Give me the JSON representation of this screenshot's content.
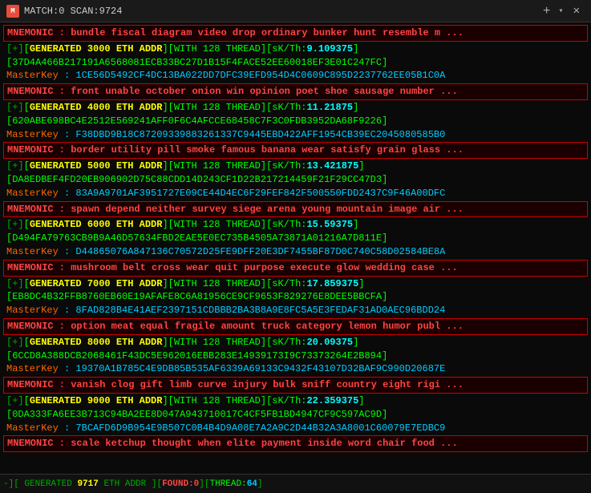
{
  "titleBar": {
    "icon": "M",
    "text": "MATCH:0 SCAN:9724",
    "closeLabel": "✕",
    "newTabLabel": "+",
    "dropdownLabel": "▾"
  },
  "statusBar": {
    "prefix": "-][",
    "generated": "GENERATED",
    "scan": "9717",
    "eth": "ETH ADDR",
    "found_label": "FOUND:",
    "found_value": "0",
    "thread_label": "THREAD:",
    "thread_value": "64"
  },
  "entries": [
    {
      "mnemonic": "MNEMONIC : bundle fiscal diagram video drop ordinary bunker hunt resemble m ...",
      "generated": "[+][GENERATED 3000 ETH ADDR][WITH 128 THREAD][sK/Th:9.109375]",
      "addr": "[37D4A466B217191A6568081ECB33BC27D1B15F4FACE52EE60018EF3E01C247FC]",
      "masterkey": "MasterKey :  1CE56D5492CF4DC13BA022DD7DFC39EFD954D4C0609C895D2237762EE05B1C0A"
    },
    {
      "mnemonic": "MNEMONIC : front unable october onion win opinion poet shoe sausage number ...",
      "generated": "[+][GENERATED 4000 ETH ADDR][WITH 128 THREAD][sK/Th:11.21875]",
      "addr": "[620ABE698BC4E2512E569241AFF0F6C4AFCCE68458C7F3C0FDB3952DA68F9226]",
      "masterkey": "MasterKey :  F38DBD9B18C87209339883261337C9445EBD422AFF1954CB39EC2045080585B0"
    },
    {
      "mnemonic": "MNEMONIC : border utility pill smoke famous banana wear satisfy grain glass ...",
      "generated": "[+][GENERATED 5000 ETH ADDR][WITH 128 THREAD][sK/Th:13.421875]",
      "addr": "[DA8EDBEF4FD20EB906902D75C88CDD14D243CF1D22B217214459F21F29CC47D3]",
      "masterkey": "MasterKey :  83A9A9701AF3951727E09CE44D4EC6F29FEF842F500550FDD2437C9F46A00DFC"
    },
    {
      "mnemonic": "MNEMONIC : spawn depend neither survey siege arena young mountain image air ...",
      "generated": "[+][GENERATED 6000 ETH ADDR][WITH 128 THREAD][sK/Th:15.59375]",
      "addr": "[D494FA79763CB9B9A46D57634FBD2EAE5E0EC735B4505A73871A01216A7D811E]",
      "masterkey": "MasterKey :  D44865076A847136C70572D25FE9DFF20E3DF7455BF87D0C740C58D02584BE8A"
    },
    {
      "mnemonic": "MNEMONIC : mushroom belt cross wear quit purpose execute glow wedding case ...",
      "generated": "[+][GENERATED 7000 ETH ADDR][WITH 128 THREAD][sK/Th:17.859375]",
      "addr": "[EB8DC4B32FFB8760EB60E19AFAFE8C6A81956CE9CF9653F829276E8DEE5BBCFA]",
      "masterkey": "MasterKey :  8FAD828B4E41AEF2397151CDBBB2BA3B8A9E8FC5A5E3FEDAF31AD0AEC96BDD24"
    },
    {
      "mnemonic": "MNEMONIC : option meat equal fragile amount truck category lemon humor publ ...",
      "generated": "[+][GENERATED 8000 ETH ADDR][WITH 128 THREAD][sK/Th:20.09375]",
      "addr": "[6CCD8A388DCB2068461F43DC5E962016EBB283E14939173I9C73373264E2B894]",
      "masterkey": "MasterKey :  19370A1B785C4E9DB85B535AF6339A69133C9432F43107D32BAF9C990D20687E"
    },
    {
      "mnemonic": "MNEMONIC : vanish clog gift limb curve injury bulk sniff country eight rigi ...",
      "generated": "[+][GENERATED 9000 ETH ADDR][WITH 128 THREAD][sK/Th:22.359375]",
      "addr": "[0DA333FA6EE3B713C94BA2EE8D047A943710017C4CF5FB1BD4947CF9C597AC9D]",
      "masterkey": "MasterKey :  7BCAFD6D9B954E9B507C0B4B4D9A08E7A2A9C2D44B32A3A8001C60079E7EDBC9"
    },
    {
      "mnemonic": "MNEMONIC : scale ketchup thought when elite payment inside word chair food ...",
      "generated": "",
      "addr": "",
      "masterkey": ""
    }
  ]
}
